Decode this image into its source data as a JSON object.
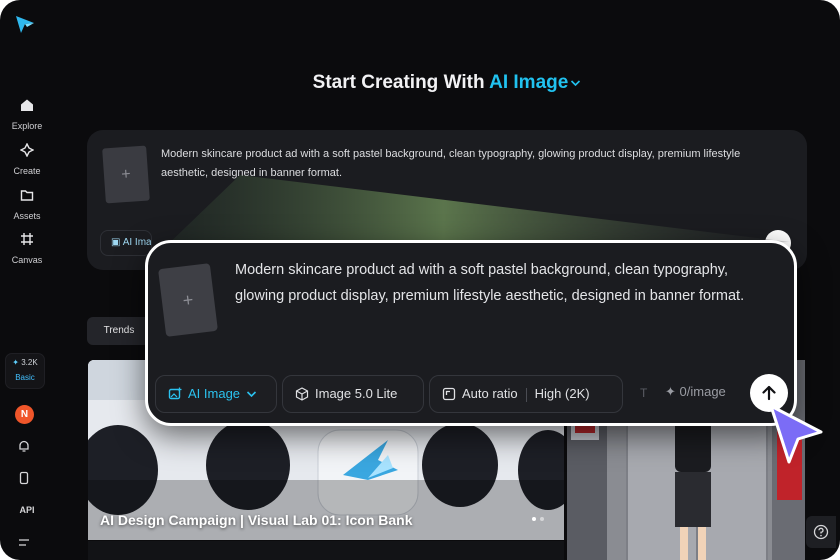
{
  "sidebar": {
    "items": [
      {
        "label": "Explore",
        "icon": "home-icon"
      },
      {
        "label": "Create",
        "icon": "sparkle-icon"
      },
      {
        "label": "Assets",
        "icon": "folder-icon"
      },
      {
        "label": "Canvas",
        "icon": "canvas-grid-icon"
      }
    ],
    "credits": {
      "amount": "3.2K",
      "plan": "Basic"
    },
    "avatar_initial": "N",
    "api_label": "API"
  },
  "headline": {
    "prefix": "Start Creating With",
    "accent": "AI Image"
  },
  "background_prompt": {
    "text": "Modern skincare product ad with a soft pastel background, clean typography, glowing product display, premium lifestyle aesthetic, designed in banner format.",
    "chip_label": "AI Image"
  },
  "prompt_panel": {
    "text": "Modern skincare product ad with a soft pastel background, clean typography, glowing product display, premium lifestyle aesthetic, designed in banner format.",
    "mode_label": "AI Image",
    "model_label": "Image 5.0 Lite",
    "ratio_label": "Auto ratio",
    "quality_label": "High (2K)",
    "credits_label": "0/image"
  },
  "gallery": {
    "tab_label": "Trends",
    "featured_title": "AI Design Campaign | Visual Lab 01: Icon Bank"
  },
  "colors": {
    "background": "#0b0b0d",
    "accent": "#21c2ef",
    "card": "#1b1c20",
    "avatar": "#f0562a",
    "cursor": "#7b6cf6"
  }
}
